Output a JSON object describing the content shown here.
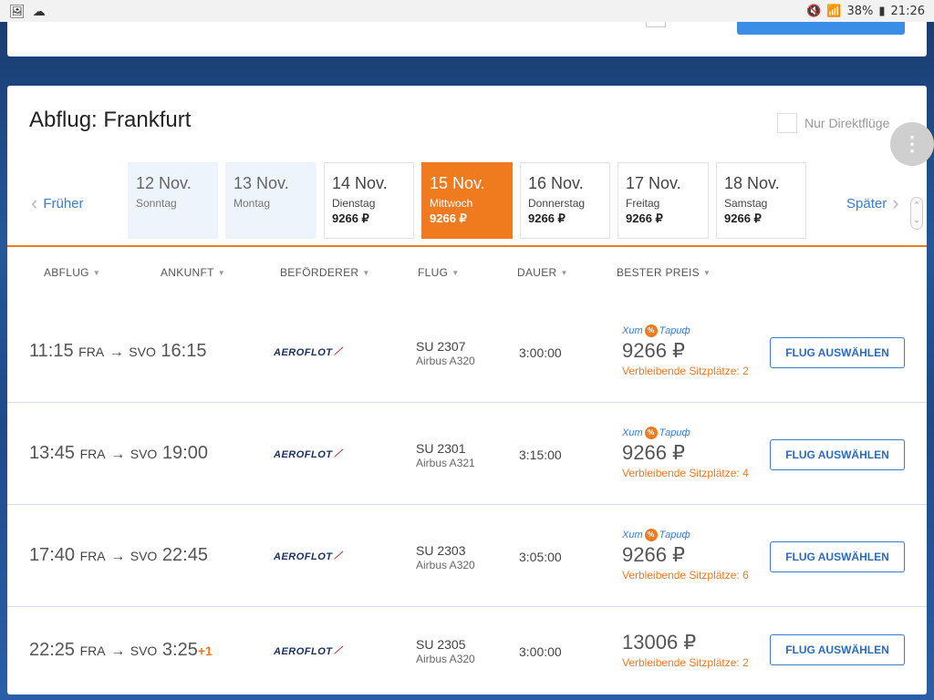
{
  "status": {
    "battery": "38%",
    "time": "21:26"
  },
  "title": "Abflug: Frankfurt",
  "direct_only": "Nur Direktflüge",
  "nav": {
    "prev": "Früher",
    "next": "Später"
  },
  "dates": [
    {
      "date": "12 Nov.",
      "weekday": "Sonntag",
      "price": "",
      "state": "past"
    },
    {
      "date": "13 Nov.",
      "weekday": "Montag",
      "price": "",
      "state": "past"
    },
    {
      "date": "14 Nov.",
      "weekday": "Dienstag",
      "price": "9266 ₽",
      "state": "normal"
    },
    {
      "date": "15 Nov.",
      "weekday": "Mittwoch",
      "price": "9266 ₽",
      "state": "active"
    },
    {
      "date": "16 Nov.",
      "weekday": "Donnerstag",
      "price": "9266 ₽",
      "state": "normal"
    },
    {
      "date": "17 Nov.",
      "weekday": "Freitag",
      "price": "9266 ₽",
      "state": "normal"
    },
    {
      "date": "18 Nov.",
      "weekday": "Samstag",
      "price": "9266 ₽",
      "state": "normal"
    }
  ],
  "columns": {
    "departure": "ABFLUG",
    "arrival": "ANKUNFT",
    "carrier": "BEFÖRDERER",
    "flight": "FLUG",
    "duration": "DAUER",
    "best_price": "BESTER PREIS"
  },
  "airline_logo_text": "AEROFLOT",
  "hit_label_a": "Хит",
  "hit_label_b": "Тариф",
  "select_label": "FLUG AUSWÄHLEN",
  "flights": [
    {
      "dep_time": "11:15",
      "dep_ap": "FRA",
      "arr_time": "16:15",
      "arr_ap": "SVO",
      "plus": "",
      "flight_no": "SU 2307",
      "aircraft": "Airbus A320",
      "duration": "3:00:00",
      "price": "9266 ₽",
      "seats": "Verbleibende Sitzplätze: 2",
      "hit": true
    },
    {
      "dep_time": "13:45",
      "dep_ap": "FRA",
      "arr_time": "19:00",
      "arr_ap": "SVO",
      "plus": "",
      "flight_no": "SU 2301",
      "aircraft": "Airbus A321",
      "duration": "3:15:00",
      "price": "9266 ₽",
      "seats": "Verbleibende Sitzplätze: 4",
      "hit": true
    },
    {
      "dep_time": "17:40",
      "dep_ap": "FRA",
      "arr_time": "22:45",
      "arr_ap": "SVO",
      "plus": "",
      "flight_no": "SU 2303",
      "aircraft": "Airbus A320",
      "duration": "3:05:00",
      "price": "9266 ₽",
      "seats": "Verbleibende Sitzplätze: 6",
      "hit": true
    },
    {
      "dep_time": "22:25",
      "dep_ap": "FRA",
      "arr_time": "3:25",
      "arr_ap": "SVO",
      "plus": "+1",
      "flight_no": "SU 2305",
      "aircraft": "Airbus A320",
      "duration": "3:00:00",
      "price": "13006 ₽",
      "seats": "Verbleibende Sitzplätze: 2",
      "hit": false
    }
  ]
}
